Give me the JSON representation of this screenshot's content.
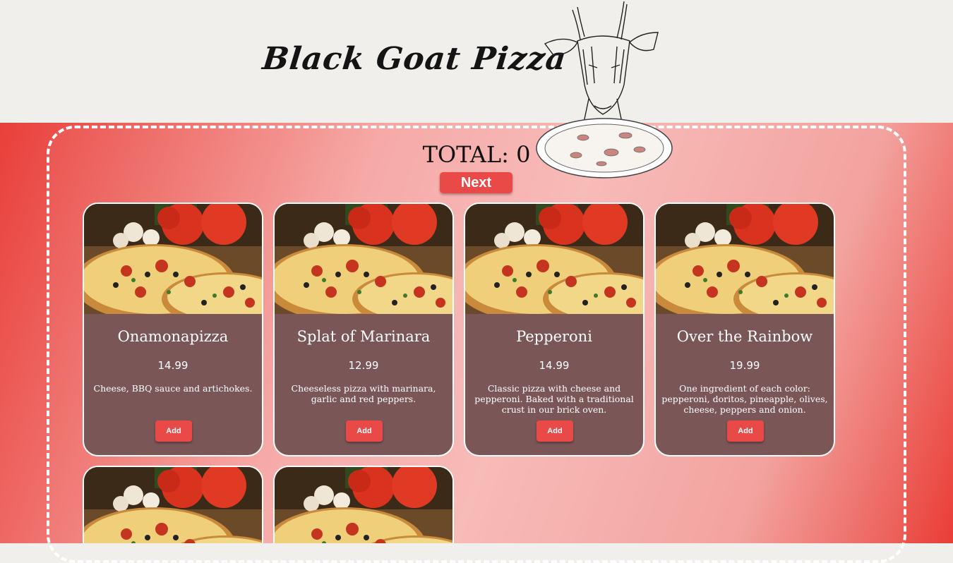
{
  "header": {
    "brand": "Black Goat Pizza",
    "logo_icon": "goat-with-pizza-illustration"
  },
  "cart": {
    "total_label": "TOTAL: 0",
    "next_label": "Next"
  },
  "colors": {
    "accent": "#ea4a47",
    "card_bg": "#7b5657",
    "header_bg": "#f0efeb"
  },
  "menu": [
    {
      "name": "Onamonapizza",
      "price": "14.99",
      "description": "Cheese, BBQ sauce and artichokes.",
      "add_label": "Add"
    },
    {
      "name": "Splat of Marinara",
      "price": "12.99",
      "description": "Cheeseless pizza with marinara, garlic and red peppers.",
      "add_label": "Add"
    },
    {
      "name": "Pepperoni",
      "price": "14.99",
      "description": "Classic pizza with cheese and pepperoni. Baked with a traditional crust in our brick oven.",
      "add_label": "Add"
    },
    {
      "name": "Over the Rainbow",
      "price": "19.99",
      "description": "One ingredient of each color: pepperoni, doritos, pineapple, olives, cheese, peppers and onion.",
      "add_label": "Add"
    },
    {
      "name": "",
      "price": "",
      "description": "",
      "add_label": ""
    },
    {
      "name": "",
      "price": "",
      "description": "",
      "add_label": ""
    }
  ]
}
